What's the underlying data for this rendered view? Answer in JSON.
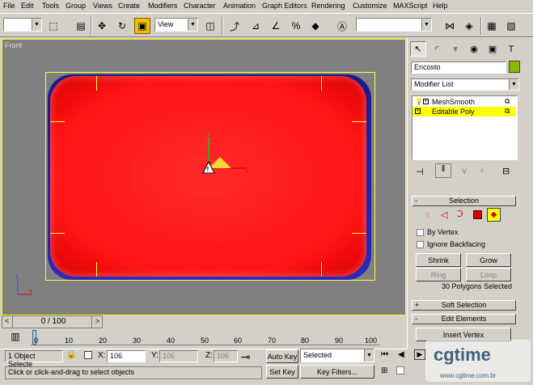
{
  "menu": [
    "File",
    "Edit",
    "Tools",
    "Group",
    "Views",
    "Create",
    "Modifiers",
    "Character",
    "Animation",
    "Graph Editors",
    "Rendering",
    "Customize",
    "MAXScript",
    "Help"
  ],
  "toolbar": {
    "selection_filter": "",
    "reference_coord": "View",
    "named_selection": ""
  },
  "viewport": {
    "label": "Front",
    "object_color": "#ff1414",
    "edge_color": "#2a2abf",
    "safe_frame_color": "#ffff40"
  },
  "time_slider": {
    "label": "0 / 100",
    "prev": "<",
    "next": ">"
  },
  "track": {
    "ticks": [
      "0",
      "10",
      "20",
      "30",
      "40",
      "50",
      "60",
      "70",
      "80",
      "90",
      "100"
    ]
  },
  "status": {
    "selection_count": "1 Object Selecte",
    "x_label": "X:",
    "x_value": "106",
    "y_label": "Y:",
    "y_value": "106",
    "z_label": "Z:",
    "z_value": "106",
    "prompt": "Click or click-and-drag to select objects",
    "auto_key": "Auto Key",
    "set_key": "Set Key",
    "key_mode": "Selected",
    "key_filters": "Key Filters..."
  },
  "panel": {
    "object_name": "Encosto",
    "object_color": "#8db800",
    "modifier_list": "Modifier List",
    "stack": [
      {
        "label": "MeshSmooth",
        "selected": false
      },
      {
        "label": "Editable Poly",
        "selected": true
      }
    ],
    "selection_rollup": "Selection",
    "by_vertex": "By Vertex",
    "ignore_backfacing": "Ignore Backfacing",
    "shrink": "Shrink",
    "grow": "Grow",
    "ring": "Ring",
    "loop": "Loop",
    "selection_status": "30 Polygons Selected",
    "soft_selection": "Soft Selection",
    "edit_elements": "Edit Elements",
    "insert_vertex": "Insert Vertex"
  },
  "watermark": {
    "brand": "cgtime",
    "url": "www.cgtime.com.br"
  }
}
